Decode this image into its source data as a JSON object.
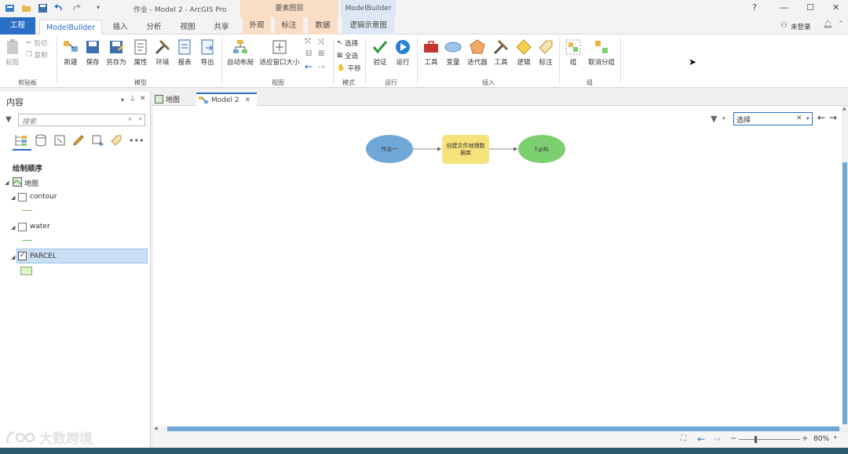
{
  "window": {
    "title": "作业 - Model 2 - ArcGIS Pro",
    "help": "?",
    "minimize": "—",
    "maximize": "☐",
    "close": "✕"
  },
  "context_headers": {
    "feature_layer": "要素图层",
    "modelbuilder": "ModelBuilder"
  },
  "tabs": {
    "project": "工程",
    "modelbuilder": "ModelBuilder",
    "insert": "插入",
    "analysis": "分析",
    "view": "视图",
    "share": "共享",
    "appearance": "外观",
    "labeling": "标注",
    "data": "数据",
    "logic_diagram": "逻辑示意图"
  },
  "user": {
    "status": "未登录"
  },
  "ribbon": {
    "clipboard": {
      "paste": "粘贴",
      "cut": "剪切",
      "copy": "复制",
      "group": "剪贴板"
    },
    "model": {
      "new": "新建",
      "save": "保存",
      "save_as": "另存为",
      "properties": "属性",
      "environment": "环境",
      "report": "报表",
      "export": "导出",
      "group": "模型"
    },
    "view": {
      "auto_layout": "自动布局",
      "fit_window": "适应窗口大小",
      "group": "视图"
    },
    "mode": {
      "select": "选择",
      "select_all": "全选",
      "pan": "平移",
      "group": "模式"
    },
    "run": {
      "validate": "验证",
      "run": "运行",
      "group": "运行"
    },
    "insert": {
      "tools": "工具",
      "variable": "变量",
      "iterator": "迭代器",
      "utilities": "工具",
      "logic": "逻辑",
      "label": "标注",
      "group": "插入"
    },
    "groupgrp": {
      "group": "组",
      "ungroup": "取消分组",
      "section": "组"
    }
  },
  "contents": {
    "title": "内容",
    "search_placeholder": "搜索",
    "drawing_order": "绘制顺序",
    "map": "地图",
    "layers": [
      {
        "name": "contour",
        "checked": false,
        "symbol_color": "#b5a06a"
      },
      {
        "name": "water",
        "checked": false,
        "symbol_color": "#6ac46a"
      },
      {
        "name": "PARCEL",
        "checked": true,
        "symbol_color": "#dff5c8"
      }
    ]
  },
  "doc_tabs": {
    "map": "地图",
    "model": "Model 2"
  },
  "canvas": {
    "search_value": "选择",
    "nodes": {
      "input": "作业一",
      "tool_line1": "创建文件地理数",
      "tool_line2": "据库",
      "output": "f.gdb"
    }
  },
  "status": {
    "zoom": "80%"
  },
  "watermark": "大数跨境",
  "colors": {
    "accent": "#2a6fc4",
    "input_node": "#6fa8d6",
    "tool_node": "#f5e27a",
    "output_node": "#7ccf6f",
    "selection": "#cce0f5"
  }
}
